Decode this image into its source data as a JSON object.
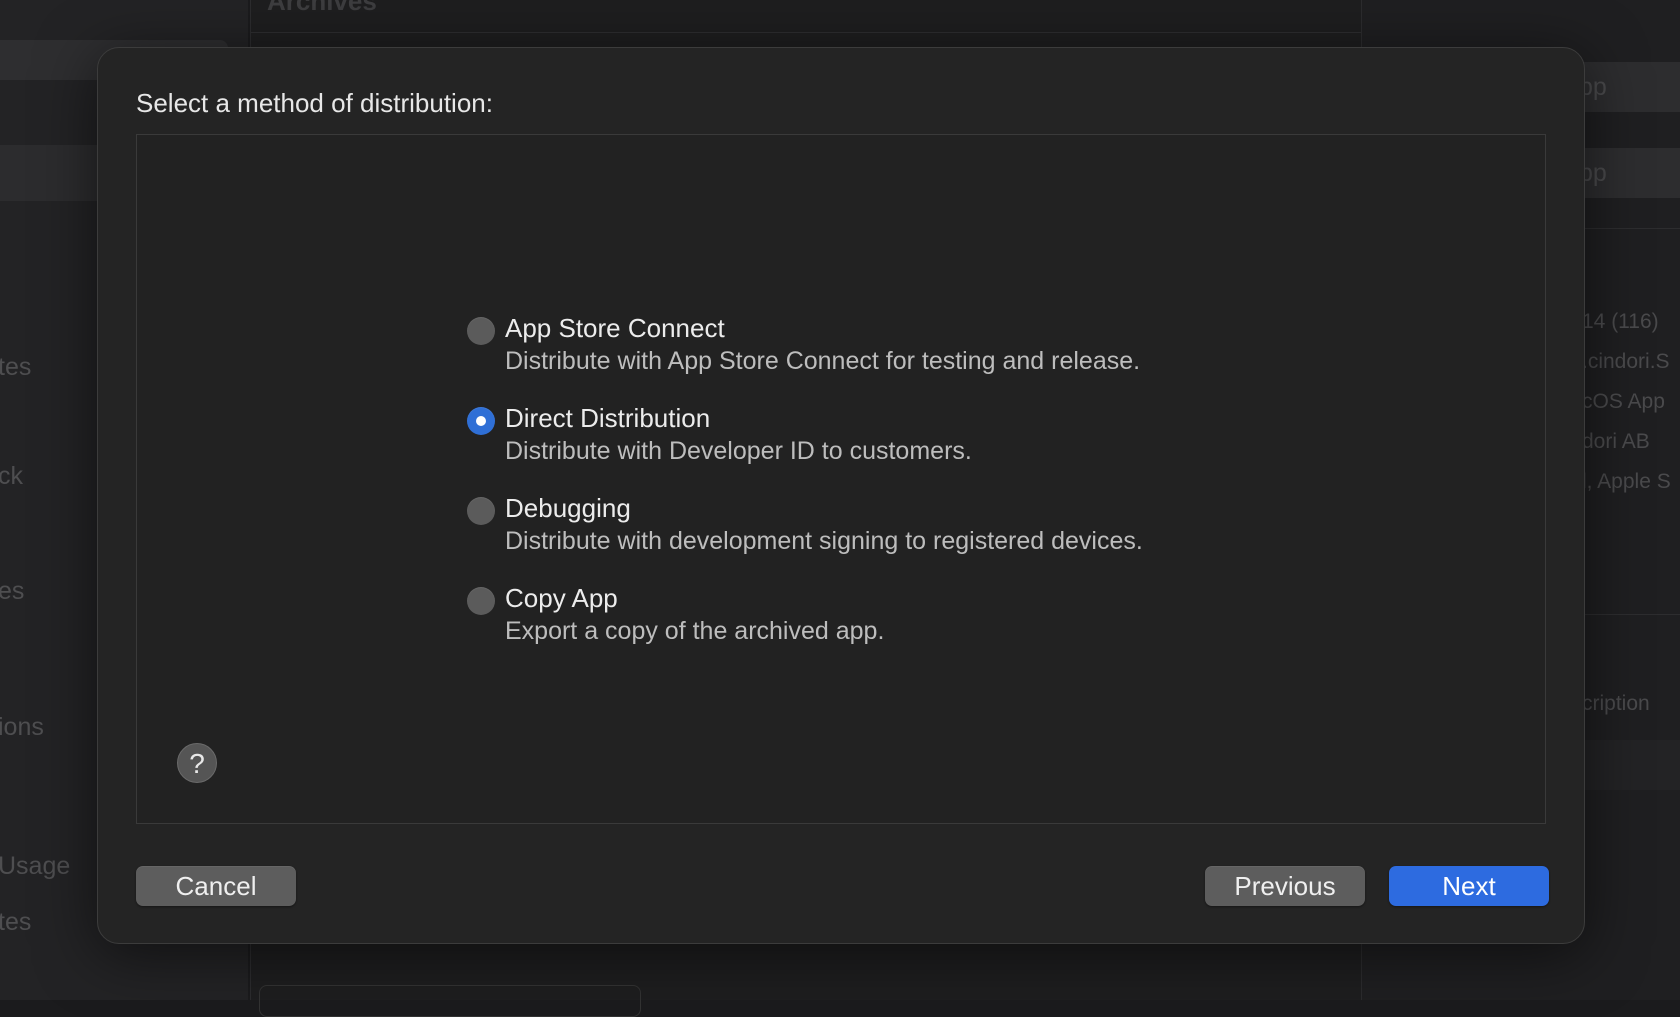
{
  "background": {
    "center_title": "Archives",
    "left_fragments": [
      "tes",
      "ck",
      "es",
      "ions",
      "Usage",
      "tes"
    ],
    "right_buttons": [
      "ute App",
      "ate App"
    ],
    "right_fragments": [
      "14 (116)",
      ".cindori.S",
      "cOS App",
      "dori AB",
      "l, Apple S",
      "cription"
    ]
  },
  "dialog": {
    "title": "Select a method of distribution:",
    "options": [
      {
        "label": "App Store Connect",
        "description": "Distribute with App Store Connect for testing and release.",
        "selected": false
      },
      {
        "label": "Direct Distribution",
        "description": "Distribute with Developer ID to customers.",
        "selected": true
      },
      {
        "label": "Debugging",
        "description": "Distribute with development signing to registered devices.",
        "selected": false
      },
      {
        "label": "Copy App",
        "description": "Export a copy of the archived app.",
        "selected": false
      }
    ],
    "help_symbol": "?",
    "cancel_label": "Cancel",
    "previous_label": "Previous",
    "next_label": "Next"
  },
  "colors": {
    "accent": "#2d6be0",
    "dialog_bg": "#242424"
  }
}
